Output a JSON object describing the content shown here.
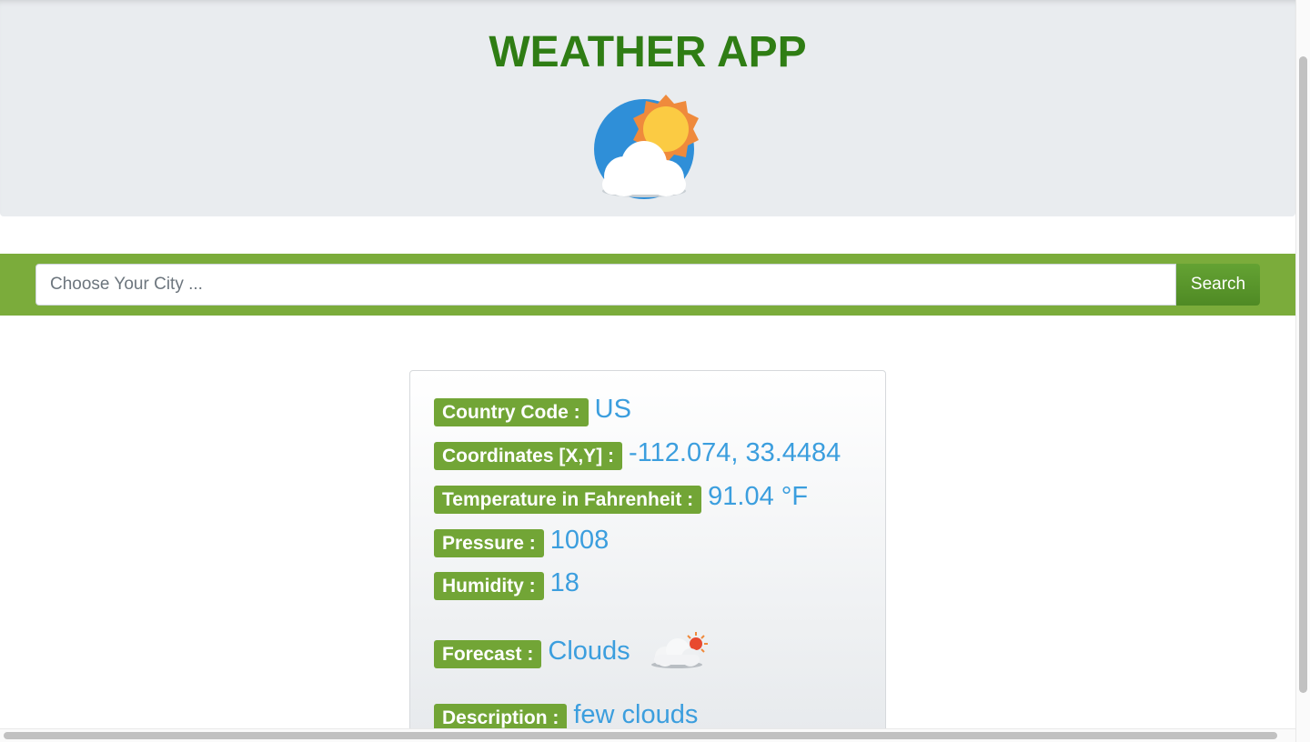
{
  "header": {
    "title": "WEATHER APP",
    "logo_icon": "sun-behind-cloud-icon"
  },
  "search": {
    "placeholder": "Choose Your City ...",
    "value": "",
    "button_label": "Search"
  },
  "result": {
    "country_code": {
      "label": "Country Code :",
      "value": "US"
    },
    "coordinates": {
      "label": "Coordinates [X,Y] :",
      "value": "-112.074, 33.4484"
    },
    "temperature": {
      "label": "Temperature in Fahrenheit :",
      "value": "91.04 °F"
    },
    "pressure": {
      "label": "Pressure :",
      "value": "1008"
    },
    "humidity": {
      "label": "Humidity :",
      "value": "18"
    },
    "forecast": {
      "label": "Forecast :",
      "value": "Clouds",
      "icon": "partly-cloudy-icon"
    },
    "description": {
      "label": "Description :",
      "value": "few clouds"
    }
  },
  "colors": {
    "title": "#2f7d14",
    "band": "#7bac3b",
    "badge": "#72a536",
    "value": "#3b9ede",
    "header_bg": "#e9ecef"
  }
}
